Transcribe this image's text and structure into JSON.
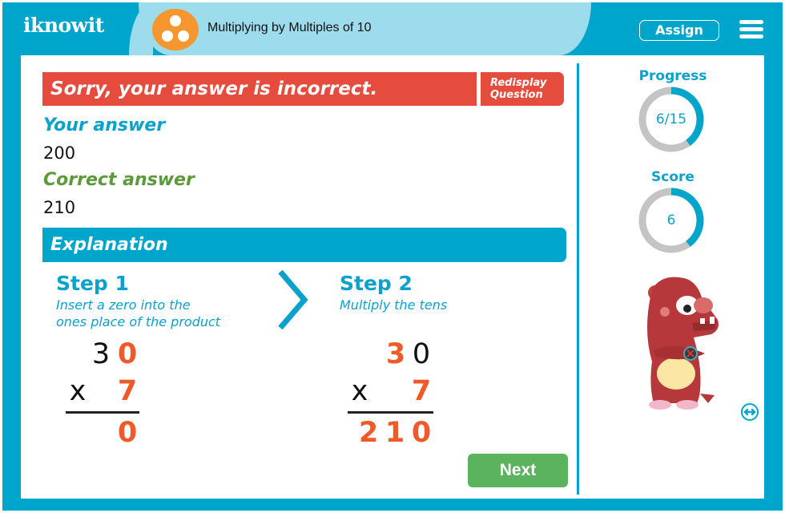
{
  "header": {
    "logo_text": "iknowit",
    "topic_title": "Multiplying by Multiples of 10",
    "assign_label": "Assign",
    "topic_icon": "three-dots-icon",
    "menu_icon": "hamburger-menu-icon"
  },
  "feedback": {
    "banner_text": "Sorry, your answer is incorrect.",
    "redisplay_line1": "Redisplay",
    "redisplay_line2": "Question",
    "your_answer_label": "Your answer",
    "your_answer_value": "200",
    "correct_answer_label": "Correct answer",
    "correct_answer_value": "210"
  },
  "explanation": {
    "title": "Explanation",
    "steps": [
      {
        "title": "Step 1",
        "desc_line1": "Insert a zero into the",
        "desc_line2": "ones place of the product",
        "work": {
          "top": [
            "3",
            "0"
          ],
          "op": "x",
          "bottom": "7",
          "result": [
            "",
            "",
            "0"
          ]
        }
      },
      {
        "title": "Step 2",
        "desc_line1": "Multiply the tens",
        "desc_line2": "",
        "work": {
          "top": [
            "3",
            "0"
          ],
          "op": "x",
          "bottom": "7",
          "result": [
            "2",
            "1",
            "0"
          ]
        }
      }
    ]
  },
  "actions": {
    "next_label": "Next"
  },
  "sidebar": {
    "progress_label": "Progress",
    "progress_value": "6/15",
    "progress_fraction": 0.4,
    "score_label": "Score",
    "score_value": "6",
    "score_fraction": 0.4
  },
  "colors": {
    "brand_blue": "#00a5cc",
    "error_red": "#e64c3d",
    "correct_green": "#5a9a3a",
    "next_green": "#5cb35e",
    "highlight_orange": "#f05a28",
    "topic_orange": "#f6962f",
    "ring_gray": "#c4c4c4"
  }
}
